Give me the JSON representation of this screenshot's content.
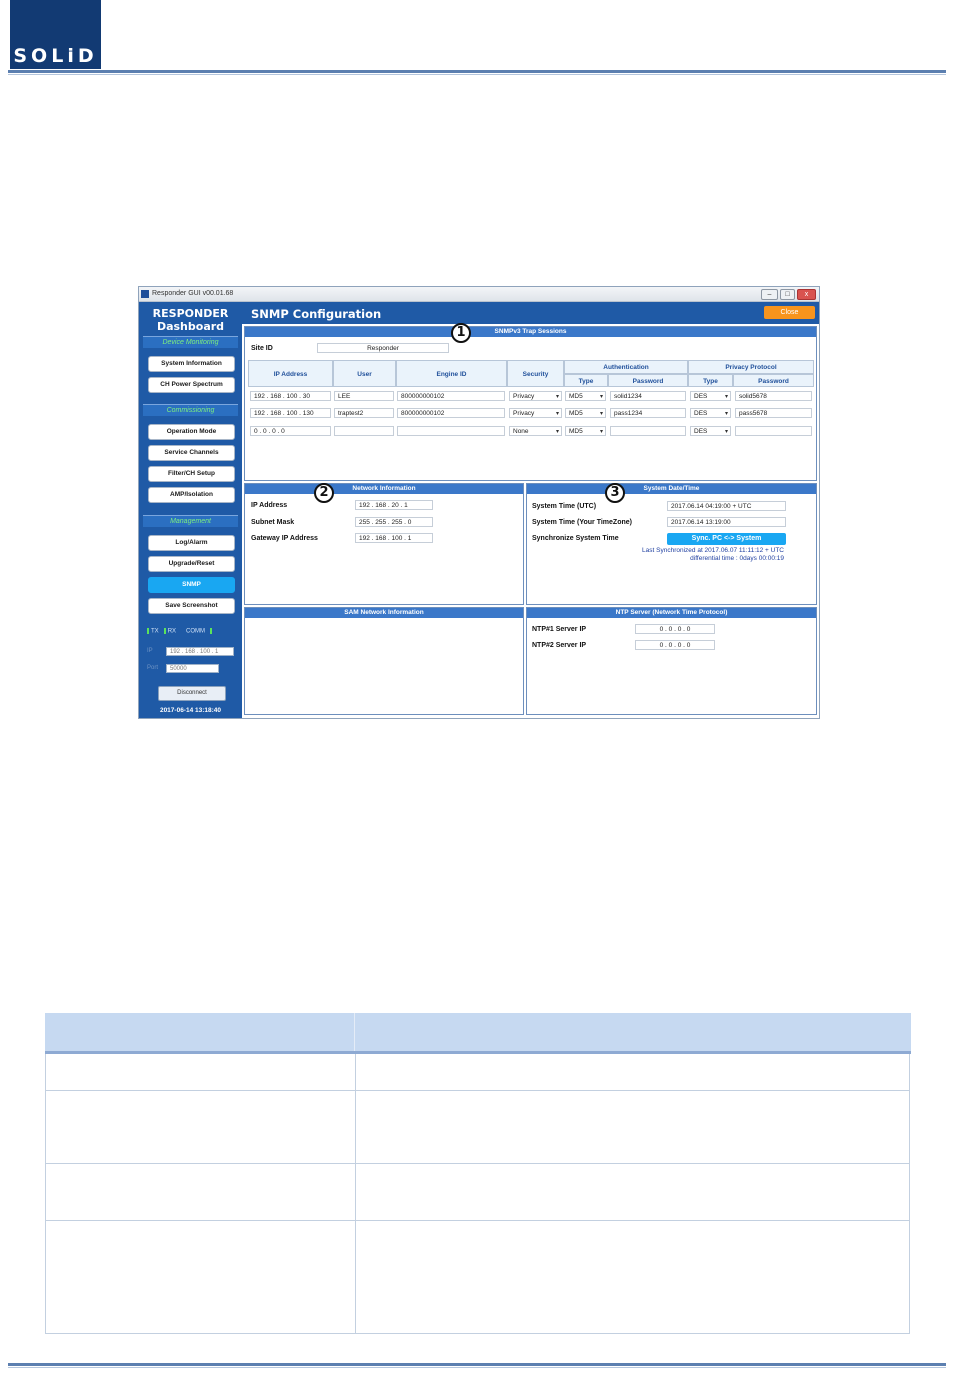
{
  "brand": {
    "logo_text": "SOLiD"
  },
  "window": {
    "title": "Responder GUI v00.01.68",
    "controls": {
      "minimize": "–",
      "maximize": "□",
      "close": "x"
    }
  },
  "sidebar": {
    "title1": "RESPONDER",
    "title2": "Dashboard",
    "sections": {
      "device_monitoring": "Device Monitoring",
      "commissioning": "Commissioning",
      "management": "Management"
    },
    "buttons": {
      "system_information": "System Information",
      "ch_power_spectrum": "CH Power Spectrum",
      "operation_mode": "Operation Mode",
      "service_channels": "Service Channels",
      "filter_ch_setup": "Filter/CH Setup",
      "amp_isolation": "AMP/Isolation",
      "log_alarm": "Log/Alarm",
      "upgrade_reset": "Upgrade/Reset",
      "snmp": "SNMP",
      "save_screenshot": "Save Screenshot"
    },
    "status": {
      "tx": "TX",
      "rx": "RX",
      "comm": "COMM"
    },
    "ip_label": "IP",
    "ip_value": "192 . 168 . 100 . 1",
    "port_label": "Port",
    "port_value": "50000",
    "disconnect": "Disconnect",
    "datetime": "2017-06-14 13:18:40"
  },
  "main": {
    "title": "SNMP Configuration",
    "close": "Close"
  },
  "markers": {
    "m1": "1",
    "m2": "2",
    "m3": "3"
  },
  "trap": {
    "header": "SNMPv3 Trap Sessions",
    "site_id_label": "Site ID",
    "site_id_value": "Responder",
    "cols": {
      "ip": "IP Address",
      "user": "User",
      "engine": "Engine ID",
      "security": "Security",
      "auth": "Authentication",
      "privacy": "Privacy Protocol",
      "type": "Type",
      "password": "Password"
    },
    "rows": [
      {
        "ip": "192 . 168 . 100 . 30",
        "user": "LEE",
        "engine": "800000000102",
        "security": "Privacy",
        "auth_type": "MD5",
        "auth_pw": "solid1234",
        "priv_type": "DES",
        "priv_pw": "solid5678"
      },
      {
        "ip": "192 . 168 . 100 . 130",
        "user": "traptest2",
        "engine": "800000000102",
        "security": "Privacy",
        "auth_type": "MD5",
        "auth_pw": "pass1234",
        "priv_type": "DES",
        "priv_pw": "pass5678"
      },
      {
        "ip": "0 . 0 . 0 . 0",
        "user": "",
        "engine": "",
        "security": "None",
        "auth_type": "MD5",
        "auth_pw": "",
        "priv_type": "DES",
        "priv_pw": ""
      }
    ]
  },
  "network": {
    "header": "Network Information",
    "ip_label": "IP Address",
    "ip_value": "192 . 168 . 20 . 1",
    "mask_label": "Subnet Mask",
    "mask_value": "255 . 255 . 255 . 0",
    "gw_label": "Gateway IP Address",
    "gw_value": "192 . 168 . 100 . 1"
  },
  "datetime": {
    "header": "System Date/Time",
    "utc_label": "System Time (UTC)",
    "utc_value": "2017.06.14 04:19:00 + UTC",
    "tz_label": "System Time (Your TimeZone)",
    "tz_value": "2017.06.14 13:19:00",
    "sync_label": "Synchronize System Time",
    "sync_button": "Sync. PC <-> System",
    "last_sync": "Last Synchronized at 2017.06.07 11:11:12 + UTC",
    "diff": "differential time : 0days 00:00:19"
  },
  "sam": {
    "header": "SAM Network Information"
  },
  "ntp": {
    "header": "NTP Server (Network Time Protocol)",
    "s1_label": "NTP#1 Server IP",
    "s1_value": "0 . 0 . 0 . 0",
    "s2_label": "NTP#2 Server IP",
    "s2_value": "0 . 0 . 0 . 0"
  }
}
